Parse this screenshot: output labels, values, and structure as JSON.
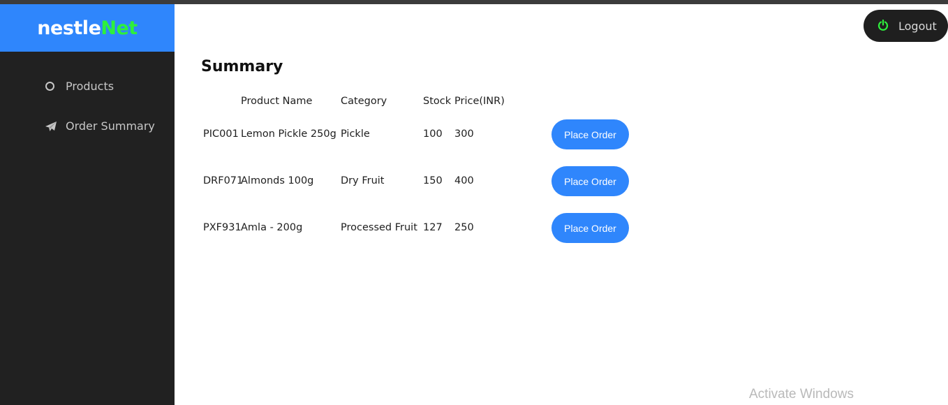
{
  "brand": {
    "part1": "nestle",
    "part2": "Net"
  },
  "sidebar": {
    "items": [
      {
        "label": "Products",
        "icon": "circle-icon"
      },
      {
        "label": "Order Summary",
        "icon": "paper-plane-icon"
      }
    ]
  },
  "header": {
    "logout_label": "Logout"
  },
  "main": {
    "title": "Summary",
    "columns": [
      "",
      "Product Name",
      "Category",
      "Stock",
      "Price(INR)"
    ],
    "rows": [
      {
        "code": "PIC001",
        "name": "Lemon Pickle 250g",
        "category": "Pickle",
        "stock": "100",
        "price": "300",
        "action": "Place Order"
      },
      {
        "code": "DRF071",
        "name": "Almonds 100g",
        "category": "Dry Fruit",
        "stock": "150",
        "price": "400",
        "action": "Place Order"
      },
      {
        "code": "PXF931",
        "name": "Amla - 200g",
        "category": "Processed Fruit",
        "stock": "127",
        "price": "250",
        "action": "Place Order"
      }
    ]
  },
  "watermark": "Activate Windows",
  "colors": {
    "brand_blue": "#2f86fc",
    "brand_green": "#2ef03c",
    "sidebar_bg": "#212121",
    "logout_bg": "#1f1f1f"
  }
}
